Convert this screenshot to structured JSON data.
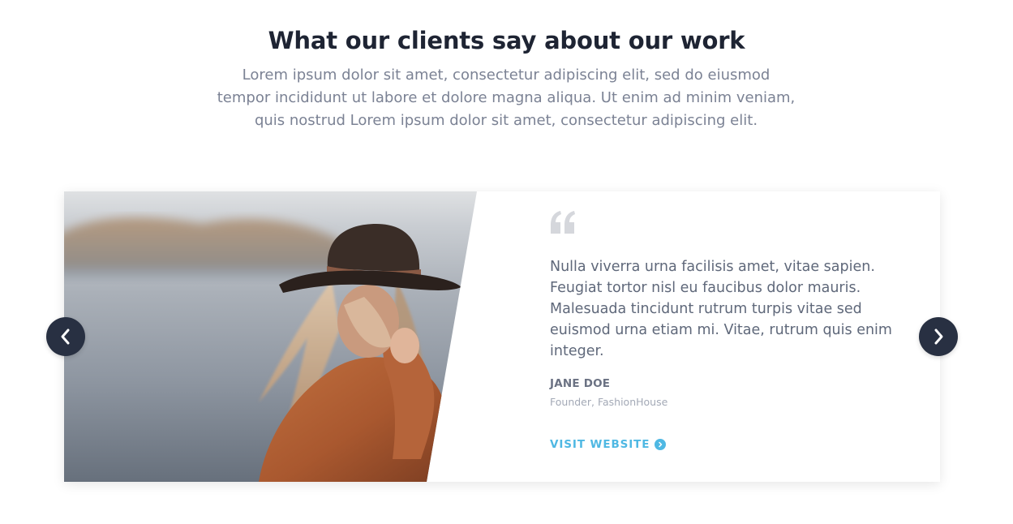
{
  "header": {
    "title": "What our clients say about our work",
    "subtitle": "Lorem ipsum dolor sit amet, consectetur adipiscing elit, sed do eiusmod tempor incididunt ut labore et dolore magna aliqua. Ut enim ad minim veniam, quis nostrud Lorem ipsum dolor sit amet, consectetur adipiscing elit."
  },
  "testimonial": {
    "quote": "Nulla viverra urna facilisis amet, vitae sapien. Feugiat tortor nisl eu faucibus dolor mauris. Malesuada tincidunt rutrum turpis vitae sed euismod urna etiam mi. Vitae, rutrum quis enim integer.",
    "author_name": "JANE DOE",
    "author_role": "Founder, FashionHouse",
    "link_label": "VISIT WEBSITE"
  },
  "icons": {
    "quote": "quote-icon",
    "prev": "chevron-left-icon",
    "next": "chevron-right-icon",
    "link_arrow": "chevron-right-circle-icon"
  },
  "colors": {
    "heading": "#1e2433",
    "body_text": "#5f687a",
    "muted": "#a3a9b6",
    "accent": "#4fb8e3",
    "nav_button": "#283042"
  }
}
